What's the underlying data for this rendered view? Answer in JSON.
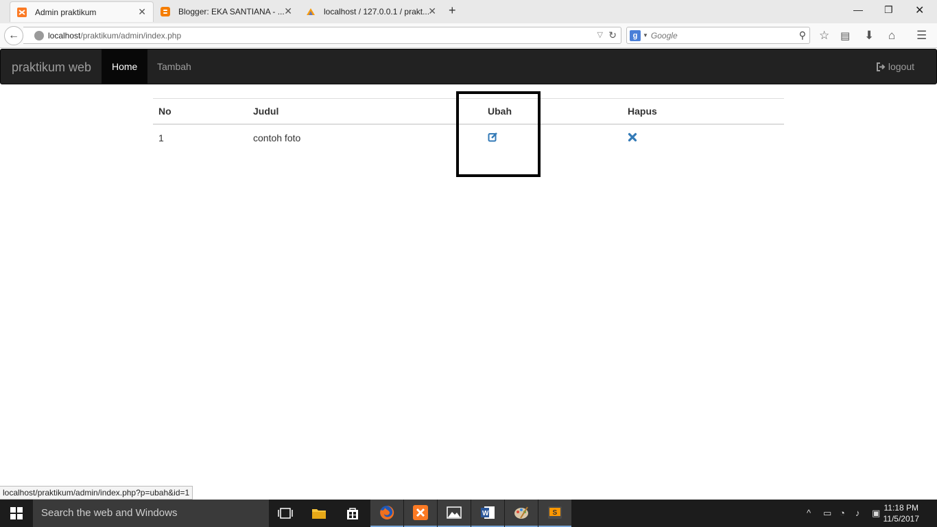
{
  "browser": {
    "tabs": [
      {
        "title": "Admin praktikum",
        "active": true
      },
      {
        "title": "Blogger: EKA SANTIANA - ...",
        "active": false
      },
      {
        "title": "localhost / 127.0.0.1 / prakt...",
        "active": false
      }
    ],
    "url_host": "localhost",
    "url_path": "/praktikum/admin/index.php",
    "search_placeholder": "Google"
  },
  "app": {
    "brand": "praktikum web",
    "nav": [
      {
        "label": "Home",
        "active": true
      },
      {
        "label": "Tambah",
        "active": false
      }
    ],
    "logout_label": "logout"
  },
  "table": {
    "headers": [
      "No",
      "Judul",
      "Ubah",
      "Hapus"
    ],
    "rows": [
      {
        "no": "1",
        "judul": "contoh foto"
      }
    ]
  },
  "status_url": "localhost/praktikum/admin/index.php?p=ubah&id=1",
  "taskbar": {
    "search_placeholder": "Search the web and Windows",
    "time": "11:18 PM",
    "date": "11/5/2017"
  },
  "colors": {
    "navbar_bg": "#222222",
    "link_blue": "#337ab7",
    "highlight_box": "#000000"
  }
}
